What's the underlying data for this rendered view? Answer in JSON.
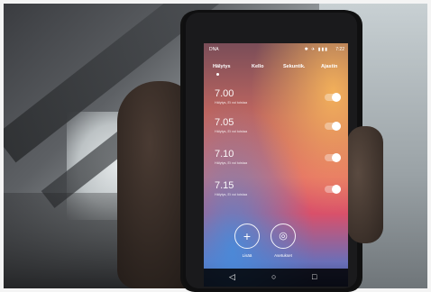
{
  "status_bar": {
    "carrier": "DNA",
    "icons": "✱ ✈ ▮▮▮",
    "time": "7:22"
  },
  "tabs": [
    {
      "label": "Hälytys",
      "active": true
    },
    {
      "label": "Kello"
    },
    {
      "label": "Sekuntik."
    },
    {
      "label": "Ajastin"
    }
  ],
  "alarms": [
    {
      "time": "7.00",
      "desc": "Hälytys, Ei voi toistaa",
      "enabled": false
    },
    {
      "time": "7.05",
      "desc": "Hälytys, Ei voi toistaa",
      "enabled": false
    },
    {
      "time": "7.10",
      "desc": "Hälytys, Ei voi toistaa",
      "enabled": false
    },
    {
      "time": "7.15",
      "desc": "Hälytys, Ei voi toistaa",
      "enabled": false
    }
  ],
  "actions": {
    "add": {
      "icon": "plus-icon",
      "glyph": "+",
      "label": "Lisää"
    },
    "settings": {
      "icon": "settings-icon",
      "glyph": "◎",
      "label": "Asetukset"
    }
  },
  "navbar": {
    "back_glyph": "◁",
    "home_glyph": "○",
    "recents_glyph": "□"
  }
}
